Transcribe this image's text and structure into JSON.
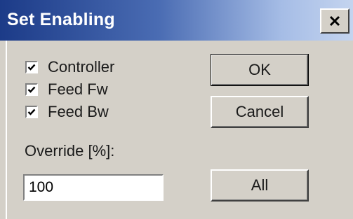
{
  "dialog": {
    "title": "Set Enabling",
    "close_symbol": "×"
  },
  "checkboxes": [
    {
      "label": "Controller",
      "checked": true
    },
    {
      "label": "Feed Fw",
      "checked": true
    },
    {
      "label": "Feed Bw",
      "checked": true
    }
  ],
  "override": {
    "label": "Override [%]:",
    "value": "100"
  },
  "buttons": {
    "ok": "OK",
    "cancel": "Cancel",
    "all": "All"
  },
  "icons": {
    "close": "close-icon",
    "check": "checkmark-icon"
  },
  "colors": {
    "face": "#d4d0c8",
    "title_start": "#1c3b88",
    "title_end": "#c4d4ef"
  }
}
